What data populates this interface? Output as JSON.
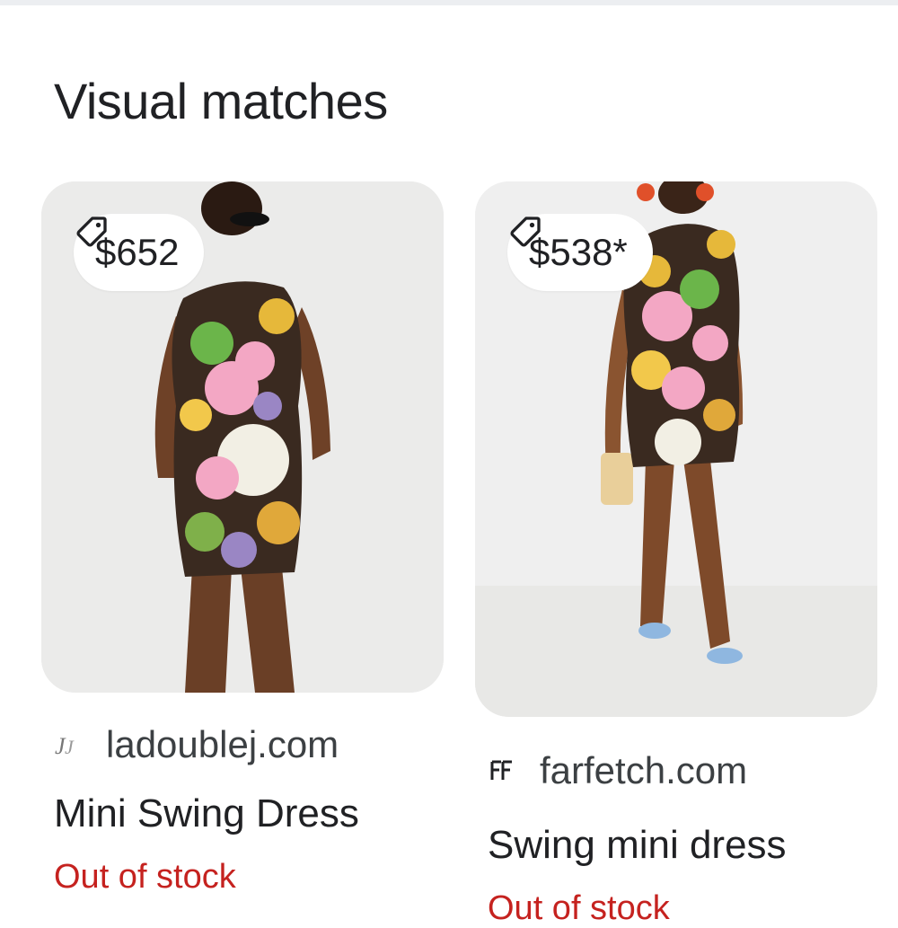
{
  "section": {
    "title": "Visual matches"
  },
  "results": [
    {
      "price": "$652",
      "source": "ladoublej.com",
      "title": "Mini Swing Dress",
      "stock": "Out of stock"
    },
    {
      "price": "$538*",
      "source": "farfetch.com",
      "title": "Swing mini dress",
      "stock": "Out of stock"
    }
  ],
  "colors": {
    "text": "#202124",
    "secondary": "#3c4043",
    "stock": "#c5221f",
    "chip_bg": "#ffffff"
  },
  "icons": {
    "price_tag": "price-tag-icon"
  }
}
